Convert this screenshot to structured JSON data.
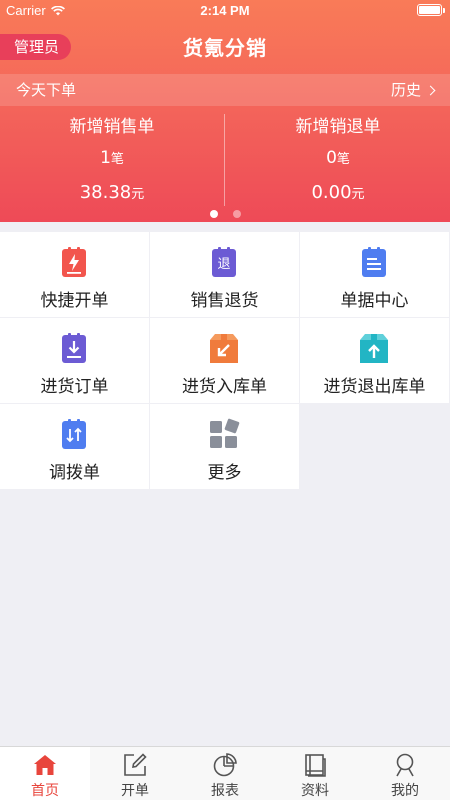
{
  "status_bar": {
    "carrier": "Carrier",
    "time": "2:14 PM"
  },
  "header": {
    "role_badge": "管理员",
    "title": "货氪分销"
  },
  "today": {
    "label": "今天下单",
    "history_link": "历史",
    "sales": {
      "title": "新增销售单",
      "count": "1",
      "count_unit": "笔",
      "amount": "38.38",
      "amount_unit": "元"
    },
    "returns": {
      "title": "新增销退单",
      "count": "0",
      "count_unit": "笔",
      "amount": "0.00",
      "amount_unit": "元"
    },
    "pager": {
      "pages": 2,
      "active": 1
    }
  },
  "grid": [
    {
      "label": "快捷开单",
      "icon": "quick-order-icon",
      "color": "#f2554d"
    },
    {
      "label": "销售退货",
      "icon": "sales-return-icon",
      "color": "#6c5bd4",
      "glyph": "退"
    },
    {
      "label": "单据中心",
      "icon": "document-center-icon",
      "color": "#4f7df0"
    },
    {
      "label": "进货订单",
      "icon": "purchase-order-icon",
      "color": "#6c5bd4"
    },
    {
      "label": "进货入库单",
      "icon": "stock-in-icon",
      "color": "#f07b3c"
    },
    {
      "label": "进货退出库单",
      "icon": "stock-out-return-icon",
      "color": "#22b5c4"
    },
    {
      "label": "调拨单",
      "icon": "transfer-icon",
      "color": "#4f7df0"
    },
    {
      "label": "更多",
      "icon": "more-icon",
      "color": "#8a8f9a"
    }
  ],
  "tabs": [
    {
      "label": "首页",
      "icon": "home-icon",
      "active": true
    },
    {
      "label": "开单",
      "icon": "edit-icon",
      "active": false
    },
    {
      "label": "报表",
      "icon": "chart-icon",
      "active": false
    },
    {
      "label": "资料",
      "icon": "book-icon",
      "active": false
    },
    {
      "label": "我的",
      "icon": "user-icon",
      "active": false
    }
  ],
  "colors": {
    "accent": "#e8453c",
    "hero_top": "#f97b58",
    "hero_bottom": "#ee4a57"
  }
}
